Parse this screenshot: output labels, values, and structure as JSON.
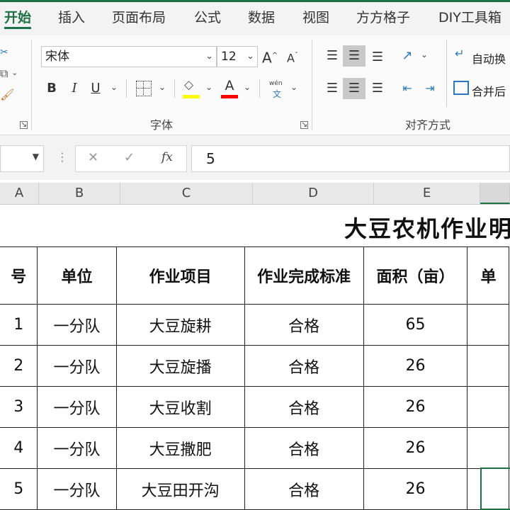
{
  "tabs": [
    {
      "label": "开始",
      "active": true
    },
    {
      "label": "插入"
    },
    {
      "label": "页面布局"
    },
    {
      "label": "公式"
    },
    {
      "label": "数据"
    },
    {
      "label": "视图"
    },
    {
      "label": "方方格子"
    },
    {
      "label": "DIY工具箱"
    }
  ],
  "ribbon": {
    "font_name": "宋体",
    "font_size": "12",
    "grow_font": "A",
    "shrink_font": "A",
    "bold": "B",
    "italic": "I",
    "underline": "U",
    "font_color_letter": "A",
    "phonetic_top": "wén",
    "phonetic_bottom": "文",
    "font_group_label": "字体",
    "wrap_text_label": "自动换",
    "merge_label": "合并后",
    "align_group_label": "对齐方式",
    "fill_color": "#ffff00",
    "font_color": "#ff0000",
    "accent": "#1e7145"
  },
  "formula_bar": {
    "cancel": "✕",
    "confirm": "✓",
    "fx": "fx",
    "value": "5"
  },
  "columns": [
    "A",
    "B",
    "C",
    "D",
    "E"
  ],
  "sheet": {
    "title": "大豆农机作业明",
    "headers": [
      "号",
      "单位",
      "作业项目",
      "作业完成标准",
      "面积（亩）",
      "单"
    ],
    "rows": [
      {
        "no": "1",
        "unit": "一分队",
        "item": "大豆旋耕",
        "standard": "合格",
        "area": "65"
      },
      {
        "no": "2",
        "unit": "一分队",
        "item": "大豆旋播",
        "standard": "合格",
        "area": "26"
      },
      {
        "no": "3",
        "unit": "一分队",
        "item": "大豆收割",
        "standard": "合格",
        "area": "26"
      },
      {
        "no": "4",
        "unit": "一分队",
        "item": "大豆撒肥",
        "standard": "合格",
        "area": "26"
      },
      {
        "no": "5",
        "unit": "一分队",
        "item": "大豆田开沟",
        "standard": "合格",
        "area": "26"
      }
    ]
  }
}
